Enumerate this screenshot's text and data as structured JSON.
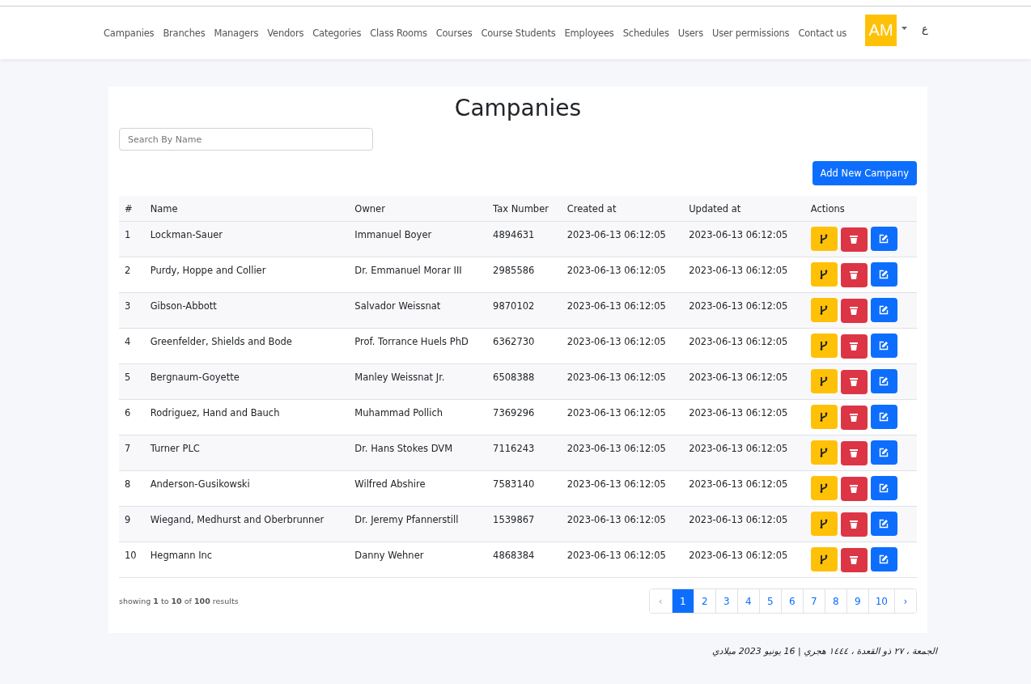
{
  "nav": {
    "links": [
      "Campanies",
      "Branches",
      "Managers",
      "Vendors",
      "Categories",
      "Class Rooms",
      "Courses",
      "Course Students",
      "Employees",
      "Schedules",
      "Users",
      "User permissions",
      "Contact us"
    ],
    "avatar": "AM",
    "language": "ع"
  },
  "page": {
    "title": "Campanies",
    "search": {
      "placeholder": "Search By Name"
    },
    "add_button": "Add New Campany"
  },
  "table": {
    "columns": [
      "#",
      "Name",
      "Owner",
      "Tax Number",
      "Created at",
      "Updated at",
      "Actions"
    ],
    "rows": [
      [
        "1",
        "Lockman-Sauer",
        "Immanuel Boyer",
        "4894631",
        "2023-06-13 06:12:05",
        "2023-06-13 06:12:05"
      ],
      [
        "2",
        "Purdy, Hoppe and Collier",
        "Dr. Emmanuel Morar III",
        "2985586",
        "2023-06-13 06:12:05",
        "2023-06-13 06:12:05"
      ],
      [
        "3",
        "Gibson-Abbott",
        "Salvador Weissnat",
        "9870102",
        "2023-06-13 06:12:05",
        "2023-06-13 06:12:05"
      ],
      [
        "4",
        "Greenfelder, Shields and Bode",
        "Prof. Torrance Huels PhD",
        "6362730",
        "2023-06-13 06:12:05",
        "2023-06-13 06:12:05"
      ],
      [
        "5",
        "Bergnaum-Goyette",
        "Manley Weissnat Jr.",
        "6508388",
        "2023-06-13 06:12:05",
        "2023-06-13 06:12:05"
      ],
      [
        "6",
        "Rodriguez, Hand and Bauch",
        "Muhammad Pollich",
        "7369296",
        "2023-06-13 06:12:05",
        "2023-06-13 06:12:05"
      ],
      [
        "7",
        "Turner PLC",
        "Dr. Hans Stokes DVM",
        "7116243",
        "2023-06-13 06:12:05",
        "2023-06-13 06:12:05"
      ],
      [
        "8",
        "Anderson-Gusikowski",
        "Wilfred Abshire",
        "7583140",
        "2023-06-13 06:12:05",
        "2023-06-13 06:12:05"
      ],
      [
        "9",
        "Wiegand, Medhurst and Oberbrunner",
        "Dr. Jeremy Pfannerstill",
        "1539867",
        "2023-06-13 06:12:05",
        "2023-06-13 06:12:05"
      ],
      [
        "10",
        "Hegmann Inc",
        "Danny Wehner",
        "4868384",
        "2023-06-13 06:12:05",
        "2023-06-13 06:12:05"
      ]
    ]
  },
  "summary": "showing **1** to **10** of **100** results",
  "pagination": {
    "prev": {
      "label": "‹",
      "disabled": true
    },
    "next": {
      "label": "›",
      "disabled": false
    },
    "pages": [
      {
        "label": "1",
        "selected": true
      },
      {
        "label": "2",
        "selected": false
      },
      {
        "label": "3",
        "selected": false
      },
      {
        "label": "4",
        "selected": false
      },
      {
        "label": "5",
        "selected": false
      },
      {
        "label": "6",
        "selected": false
      },
      {
        "label": "7",
        "selected": false
      },
      {
        "label": "8",
        "selected": false
      },
      {
        "label": "9",
        "selected": false
      },
      {
        "label": "10",
        "selected": false
      }
    ]
  },
  "footer_date": "الجمعة ، ٢٧ ذو القعدة ، ١٤٤٤ هجري | 16 يونيو 2023 ميلادي"
}
